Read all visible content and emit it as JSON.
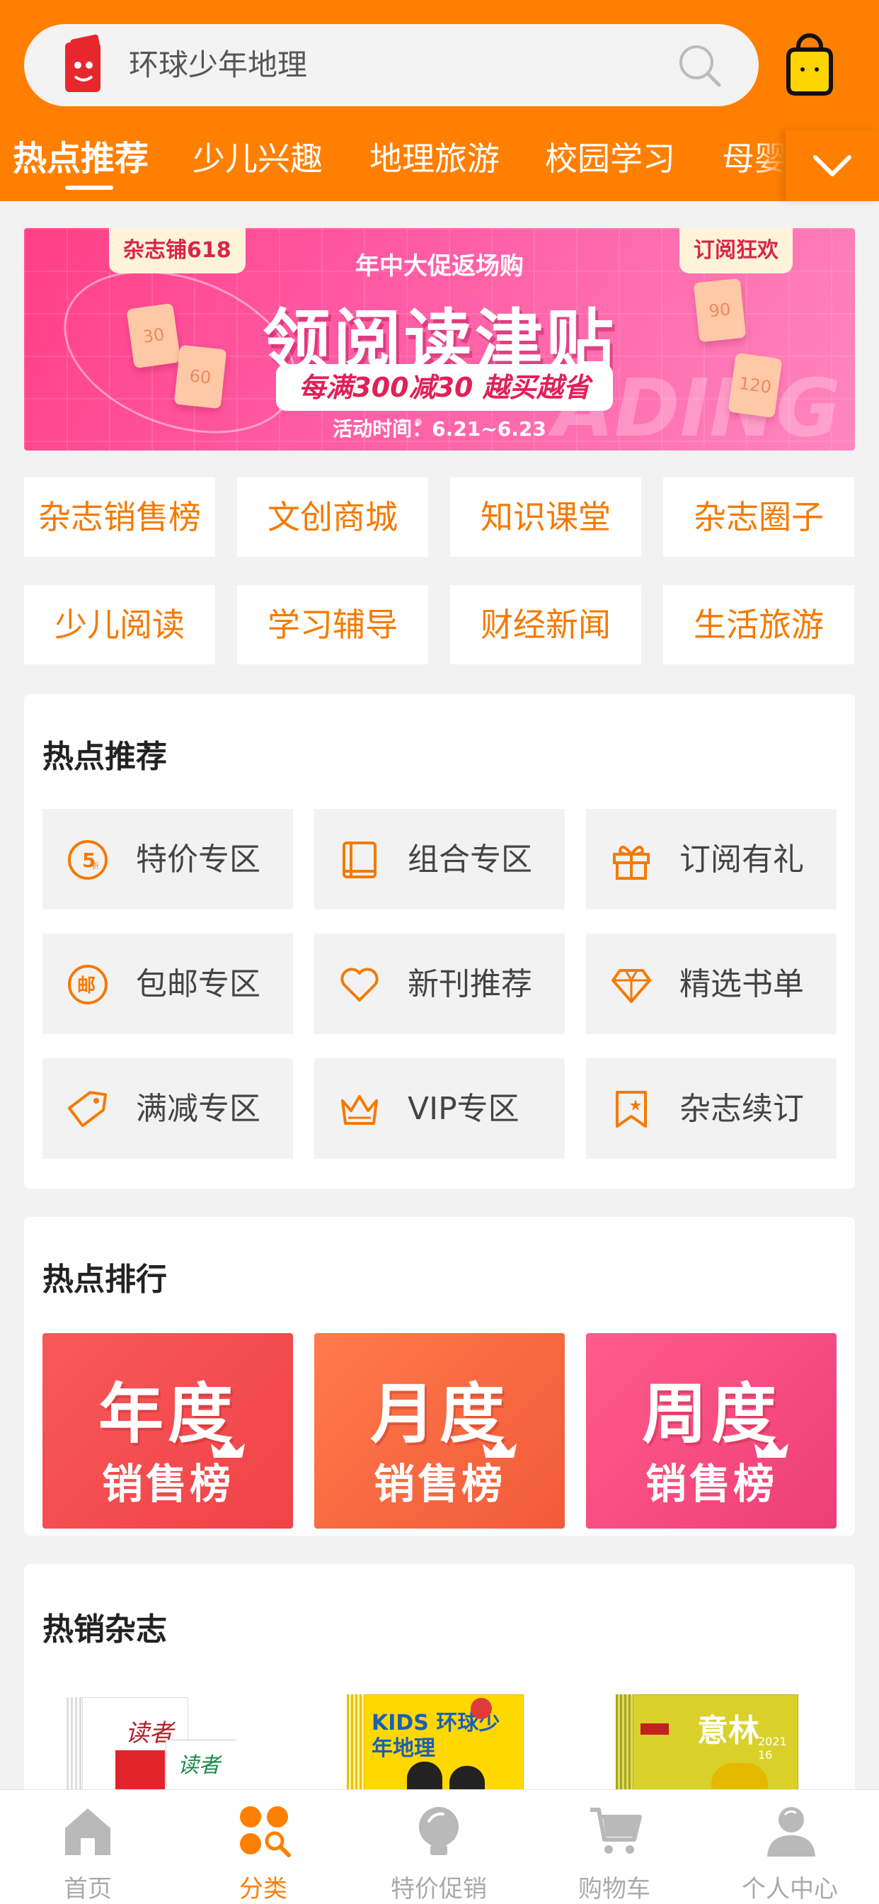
{
  "search": {
    "placeholder": "环球少年地理"
  },
  "tabs": [
    {
      "label": "热点推荐",
      "active": true
    },
    {
      "label": "少儿兴趣"
    },
    {
      "label": "地理旅游"
    },
    {
      "label": "校园学习"
    },
    {
      "label": "母婴"
    }
  ],
  "banner": {
    "tag_left": "杂志铺618",
    "tag_right": "订阅狂欢",
    "headline": "年中大促返场购",
    "title": "领阅读津贴",
    "pill": "每满300减30 越买越省",
    "date": "活动时间：6.21~6.23",
    "watermark": "ADING",
    "tickets": [
      "30",
      "60",
      "90",
      "120"
    ]
  },
  "quick_links": [
    "杂志销售榜",
    "文创商城",
    "知识课堂",
    "杂志圈子",
    "少儿阅读",
    "学习辅导",
    "财经新闻",
    "生活旅游"
  ],
  "hot_recommend": {
    "title": "热点推荐",
    "items": [
      {
        "label": "特价专区",
        "icon": "discount-5-icon"
      },
      {
        "label": "组合专区",
        "icon": "book-icon"
      },
      {
        "label": "订阅有礼",
        "icon": "gift-icon"
      },
      {
        "label": "包邮专区",
        "icon": "mail-icon"
      },
      {
        "label": "新刊推荐",
        "icon": "heart-icon"
      },
      {
        "label": "精选书单",
        "icon": "diamond-icon"
      },
      {
        "label": "满减专区",
        "icon": "price-tag-icon"
      },
      {
        "label": "VIP专区",
        "icon": "crown-icon"
      },
      {
        "label": "杂志续订",
        "icon": "bookmark-icon"
      }
    ]
  },
  "hot_ranking": {
    "title": "热点排行",
    "items": [
      {
        "line1": "年度",
        "line2": "销售榜",
        "color": "#f0484e"
      },
      {
        "line1": "月度",
        "line2": "销售榜",
        "color": "#f5673e"
      },
      {
        "line1": "周度",
        "line2": "销售榜",
        "color": "#f34b7e"
      }
    ]
  },
  "hot_magazines": {
    "title": "热销杂志",
    "items": [
      {
        "cover_text": "读者",
        "cover_text_2": "读者"
      },
      {
        "cover_text": "KIDS 环球少年地理"
      },
      {
        "cover_text": "意林",
        "issue": "2021 16"
      }
    ]
  },
  "bottom_nav": [
    {
      "label": "首页",
      "icon": "home-icon"
    },
    {
      "label": "分类",
      "icon": "category-icon",
      "active": true
    },
    {
      "label": "特价促销",
      "icon": "lightbulb-icon"
    },
    {
      "label": "购物车",
      "icon": "cart-icon"
    },
    {
      "label": "个人中心",
      "icon": "user-icon"
    }
  ],
  "colors": {
    "primary": "#ff7f00",
    "link_orange": "#f47a00",
    "banner_pink": "#ff4f98"
  }
}
